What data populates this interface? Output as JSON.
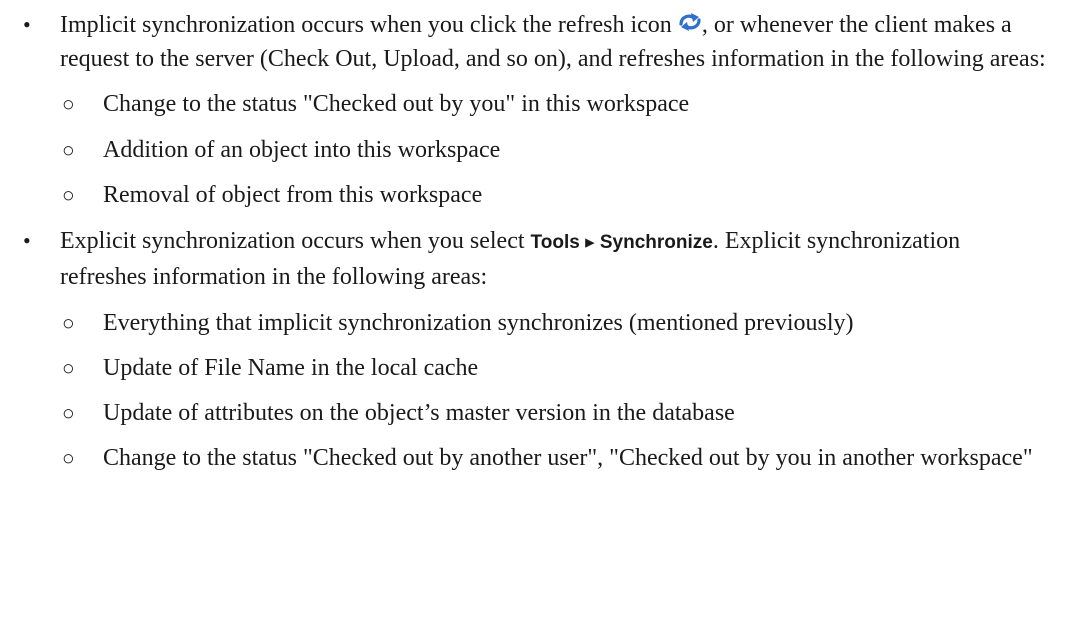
{
  "colors": {
    "text": "#1a1a1a",
    "icon": "#2f6fce"
  },
  "items": [
    {
      "text_before_icon": "Implicit synchronization occurs when you click the refresh icon ",
      "icon": "refresh-icon",
      "text_after_icon": ", or whenever the client makes a request to the server (Check Out, Upload, and so on), and refreshes information in the following areas:",
      "subitems": [
        "Change to the status \"Checked out by you\" in this workspace",
        "Addition of an object into this workspace",
        "Removal of object from this workspace"
      ]
    },
    {
      "text_before_ui": "Explicit synchronization occurs when you select ",
      "ui_path": "Tools ▸ Synchronize",
      "text_after_ui": ". Explicit synchronization refreshes information in the following areas:",
      "subitems": [
        "Everything that implicit synchronization synchronizes (mentioned previously)",
        "Update of File Name in the local cache",
        "Update of attributes on the object’s master version in the database",
        "Change to the status \"Checked out by another user\", \"Checked out by you in another workspace\""
      ]
    }
  ],
  "bullets": {
    "level1": "•",
    "level2": "○"
  }
}
